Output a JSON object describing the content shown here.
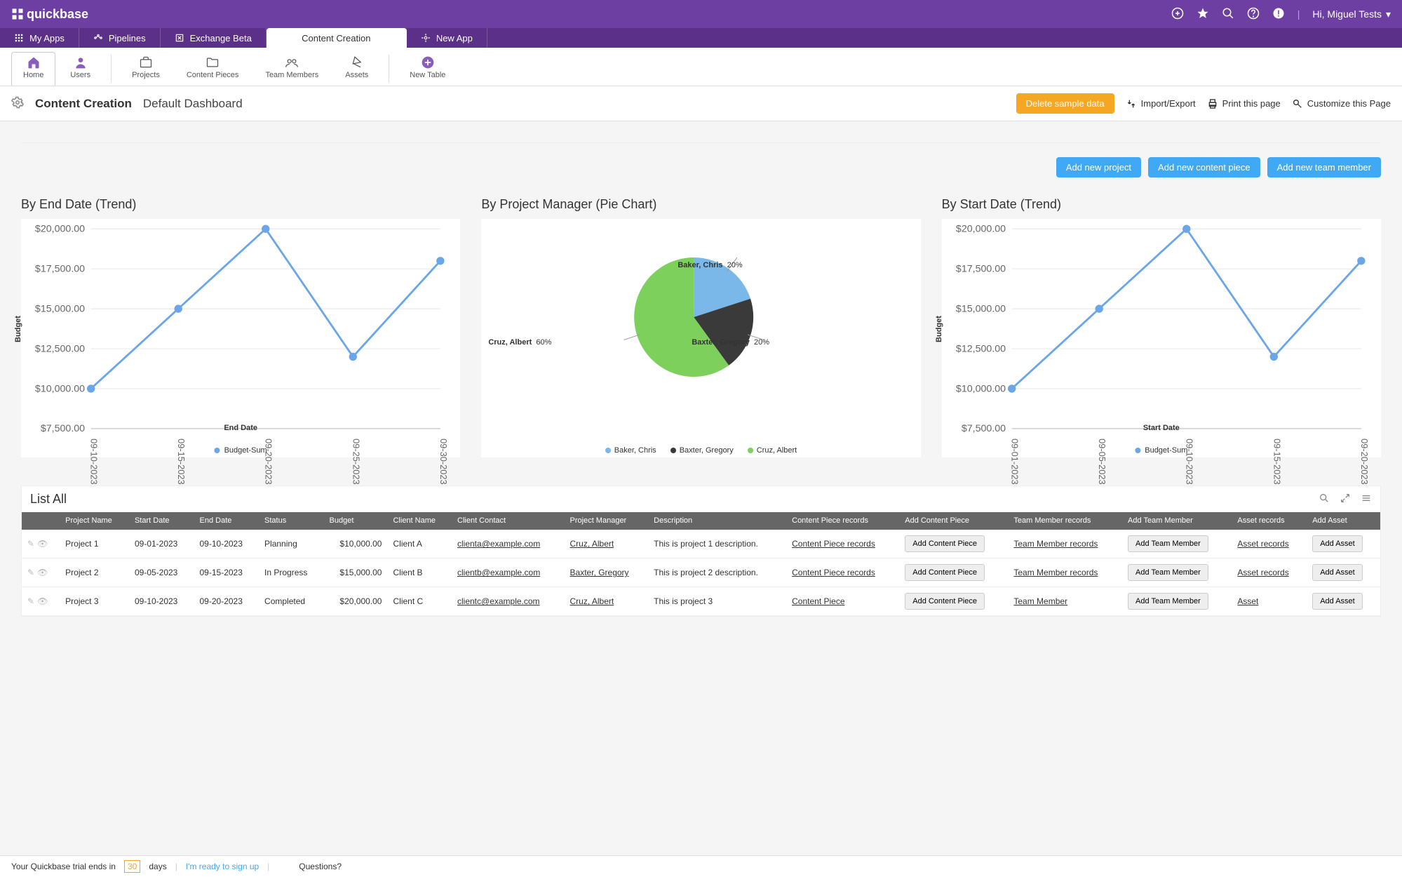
{
  "brand": "quickbase",
  "topbar": {
    "greeting": "Hi, Miguel Tests"
  },
  "nav": {
    "tabs": [
      "My Apps",
      "Pipelines",
      "Exchange Beta",
      "Content Creation",
      "New App"
    ],
    "activeIndex": 3
  },
  "subtoolbar": {
    "items": [
      "Home",
      "Users",
      "Projects",
      "Content Pieces",
      "Team Members",
      "Assets",
      "New Table"
    ],
    "activeIndex": 0
  },
  "page": {
    "title": "Content Creation",
    "subtitle": "Default Dashboard",
    "delete_btn": "Delete sample data",
    "actions": [
      "Import/Export",
      "Print this page",
      "Customize this Page"
    ]
  },
  "addButtons": [
    "Add new project",
    "Add new content piece",
    "Add new team member"
  ],
  "chart1": {
    "title": "By End Date (Trend)",
    "ylabel": "Budget",
    "xlabel": "End Date",
    "legend": "Budget-Sum"
  },
  "chart2": {
    "title": "By Project Manager (Pie Chart)"
  },
  "chart3": {
    "title": "By Start Date (Trend)",
    "ylabel": "Budget",
    "xlabel": "Start Date",
    "legend": "Budget-Sum"
  },
  "pie_labels": {
    "baker": {
      "name": "Baker, Chris",
      "pct": "20%"
    },
    "baxter": {
      "name": "Baxter, Gregory",
      "pct": "20%"
    },
    "cruz": {
      "name": "Cruz, Albert",
      "pct": "60%"
    }
  },
  "yticks": [
    "$20,000.00",
    "$17,500.00",
    "$15,000.00",
    "$12,500.00",
    "$10,000.00",
    "$7,500.00"
  ],
  "chart_data": [
    {
      "type": "line",
      "title": "By End Date (Trend)",
      "xlabel": "End Date",
      "ylabel": "Budget",
      "categories": [
        "09-10-2023",
        "09-15-2023",
        "09-20-2023",
        "09-25-2023",
        "09-30-2023"
      ],
      "series": [
        {
          "name": "Budget-Sum",
          "values": [
            10000,
            15000,
            20000,
            12000,
            18000
          ]
        }
      ],
      "ylim": [
        7500,
        20000
      ]
    },
    {
      "type": "pie",
      "title": "By Project Manager (Pie Chart)",
      "slices": [
        {
          "name": "Baker, Chris",
          "pct": 20,
          "color": "#79b8e8"
        },
        {
          "name": "Baxter, Gregory",
          "pct": 20,
          "color": "#3a3a3a"
        },
        {
          "name": "Cruz, Albert",
          "pct": 60,
          "color": "#7ed05d"
        }
      ]
    },
    {
      "type": "line",
      "title": "By Start Date (Trend)",
      "xlabel": "Start Date",
      "ylabel": "Budget",
      "categories": [
        "09-01-2023",
        "09-05-2023",
        "09-10-2023",
        "09-15-2023",
        "09-20-2023"
      ],
      "series": [
        {
          "name": "Budget-Sum",
          "values": [
            10000,
            15000,
            20000,
            12000,
            18000
          ]
        }
      ],
      "ylim": [
        7500,
        20000
      ]
    }
  ],
  "list": {
    "title": "List All",
    "headers": [
      "",
      "Project Name",
      "Start Date",
      "End Date",
      "Status",
      "Budget",
      "Client Name",
      "Client Contact",
      "Project Manager",
      "Description",
      "Content Piece records",
      "Add Content Piece",
      "Team Member records",
      "Add Team Member",
      "Asset records",
      "Add Asset"
    ],
    "rows": [
      {
        "name": "Project 1",
        "start": "09-01-2023",
        "end": "09-10-2023",
        "status": "Planning",
        "budget": "$10,000.00",
        "client": "Client A",
        "contact": "clienta@example.com",
        "manager": "Cruz, Albert",
        "desc": "This is project 1 description.",
        "cp": "Content Piece records",
        "addcp": "Add  Content Piece",
        "tm": "Team Member records",
        "addtm": "Add  Team Member",
        "asset": "Asset records",
        "addasset": "Add  Asset"
      },
      {
        "name": "Project 2",
        "start": "09-05-2023",
        "end": "09-15-2023",
        "status": "In Progress",
        "budget": "$15,000.00",
        "client": "Client B",
        "contact": "clientb@example.com",
        "manager": "Baxter, Gregory",
        "desc": "This is project 2 description.",
        "cp": "Content Piece records",
        "addcp": "Add  Content Piece",
        "tm": "Team Member records",
        "addtm": "Add  Team Member",
        "asset": "Asset records",
        "addasset": "Add  Asset"
      },
      {
        "name": "Project 3",
        "start": "09-10-2023",
        "end": "09-20-2023",
        "status": "Completed",
        "budget": "$20,000.00",
        "client": "Client C",
        "contact": "clientc@example.com",
        "manager": "Cruz, Albert",
        "desc": "This is project 3",
        "cp": "Content Piece",
        "addcp": "Add  Content Piece",
        "tm": "Team Member",
        "addtm": "Add  Team Member",
        "asset": "Asset",
        "addasset": "Add  Asset"
      }
    ]
  },
  "bottombar": {
    "prefix": "Your Quickbase trial ends in",
    "days": "30",
    "suffix": "days",
    "signup": "I'm ready to sign up",
    "questions": "Questions?"
  }
}
